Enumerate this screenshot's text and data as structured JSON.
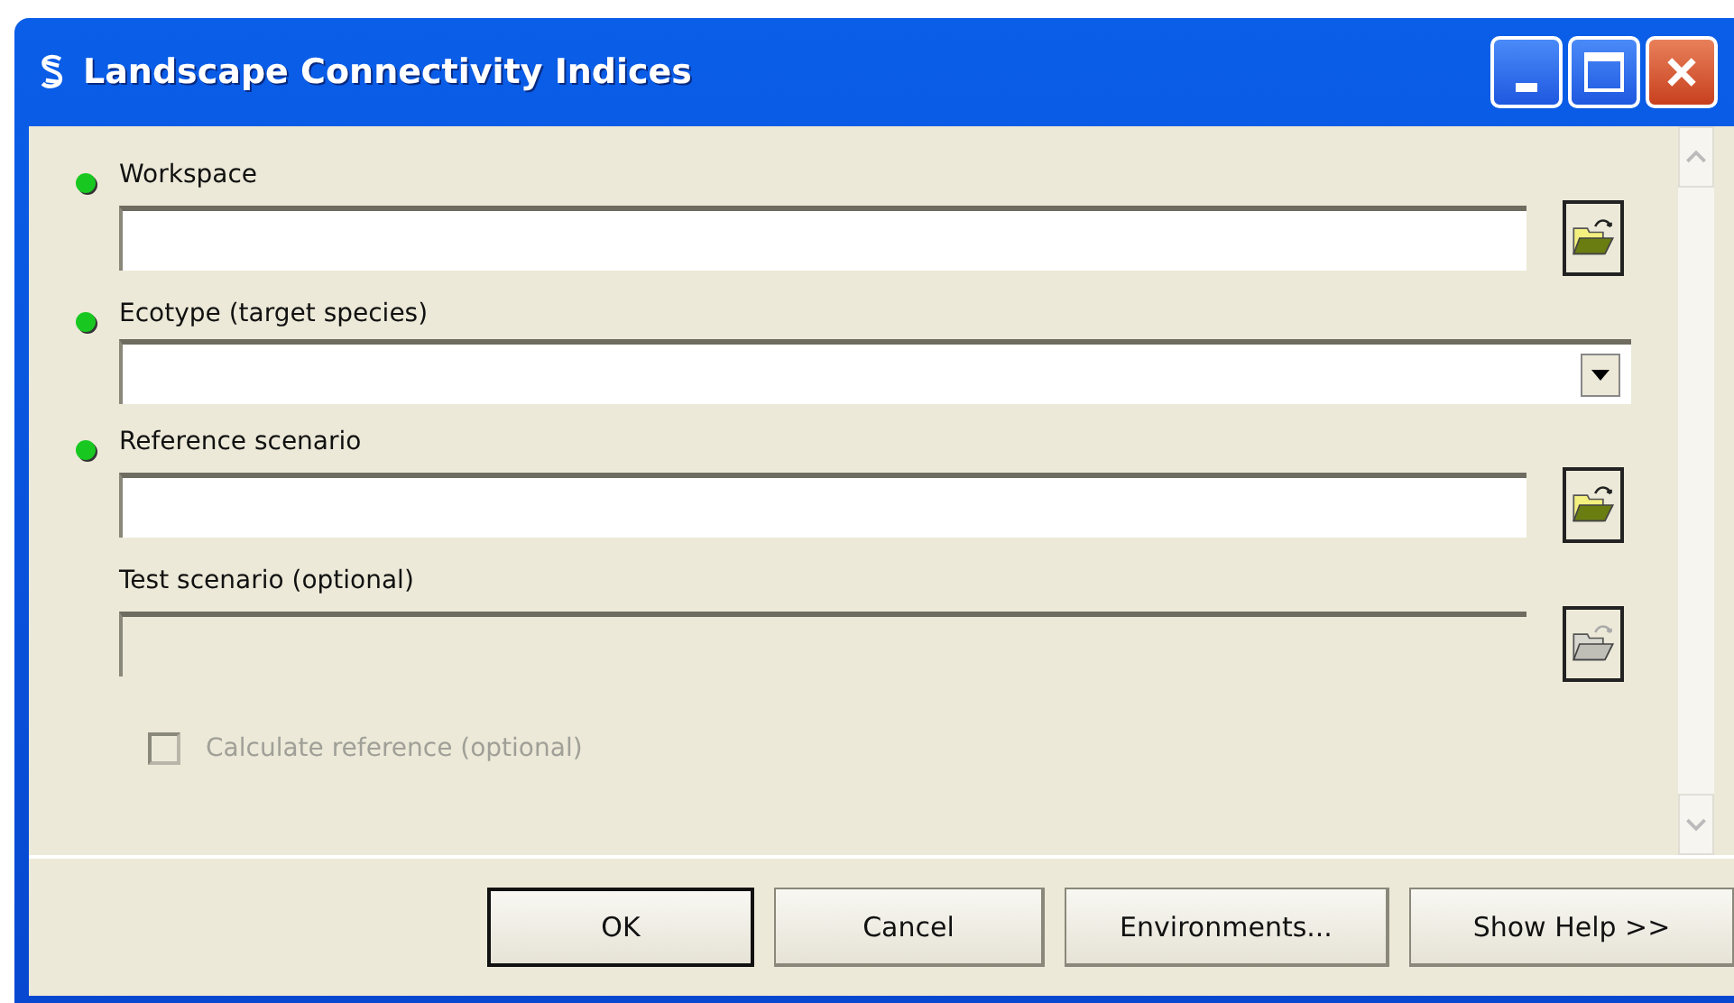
{
  "window": {
    "title": "Landscape Connectivity Indices"
  },
  "params": [
    {
      "kind": "browse",
      "label": "Workspace",
      "required": true,
      "disabled": false
    },
    {
      "kind": "dropdown",
      "label": "Ecotype (target species)",
      "required": true,
      "disabled": false
    },
    {
      "kind": "browse",
      "label": "Reference scenario",
      "required": true,
      "disabled": false
    },
    {
      "kind": "browse",
      "label": "Test scenario (optional)",
      "required": false,
      "disabled": true
    },
    {
      "kind": "checkbox",
      "label": "Calculate reference (optional)",
      "required": false,
      "disabled": true,
      "checked": false
    }
  ],
  "buttons": [
    {
      "label": "OK",
      "default": true
    },
    {
      "label": "Cancel",
      "default": false
    },
    {
      "label": "Environments...",
      "default": false
    },
    {
      "label": "Show Help >>",
      "default": false
    }
  ]
}
